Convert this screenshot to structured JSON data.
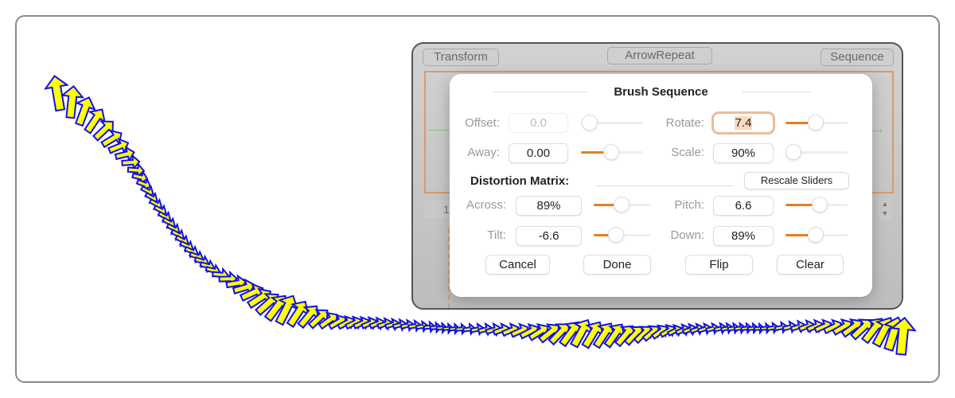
{
  "canvas": {
    "arrow_fill": "#ffff00",
    "arrow_stroke": "#1010ee",
    "brush": "arrow-icon"
  },
  "panel": {
    "transform_label": "Transform",
    "title_label": "ArrowRepeat",
    "sequence_label": "Sequence",
    "lower_field_value": "1"
  },
  "dialog": {
    "title": "Brush Sequence",
    "offset": {
      "label": "Offset:",
      "value": "0.0",
      "slider": 0.14,
      "enabled": false
    },
    "rotate": {
      "label": "Rotate:",
      "value": "7.4",
      "slider": 0.49
    },
    "away": {
      "label": "Away:",
      "value": "0.00",
      "slider": 0.49
    },
    "scale": {
      "label": "Scale:",
      "value": "90%",
      "slider": 0.13
    },
    "distortion_label": "Distortion Matrix:",
    "rescale_label": "Rescale Sliders",
    "across": {
      "label": "Across:",
      "value": "89%",
      "slider": 0.49
    },
    "pitch": {
      "label": "Pitch:",
      "value": "6.6",
      "slider": 0.55
    },
    "tilt": {
      "label": "Tilt:",
      "value": "-6.6",
      "slider": 0.39
    },
    "down": {
      "label": "Down:",
      "value": "89%",
      "slider": 0.49
    },
    "buttons": {
      "cancel": "Cancel",
      "done": "Done",
      "flip": "Flip",
      "clear": "Clear"
    },
    "accent": "#e67e22"
  }
}
